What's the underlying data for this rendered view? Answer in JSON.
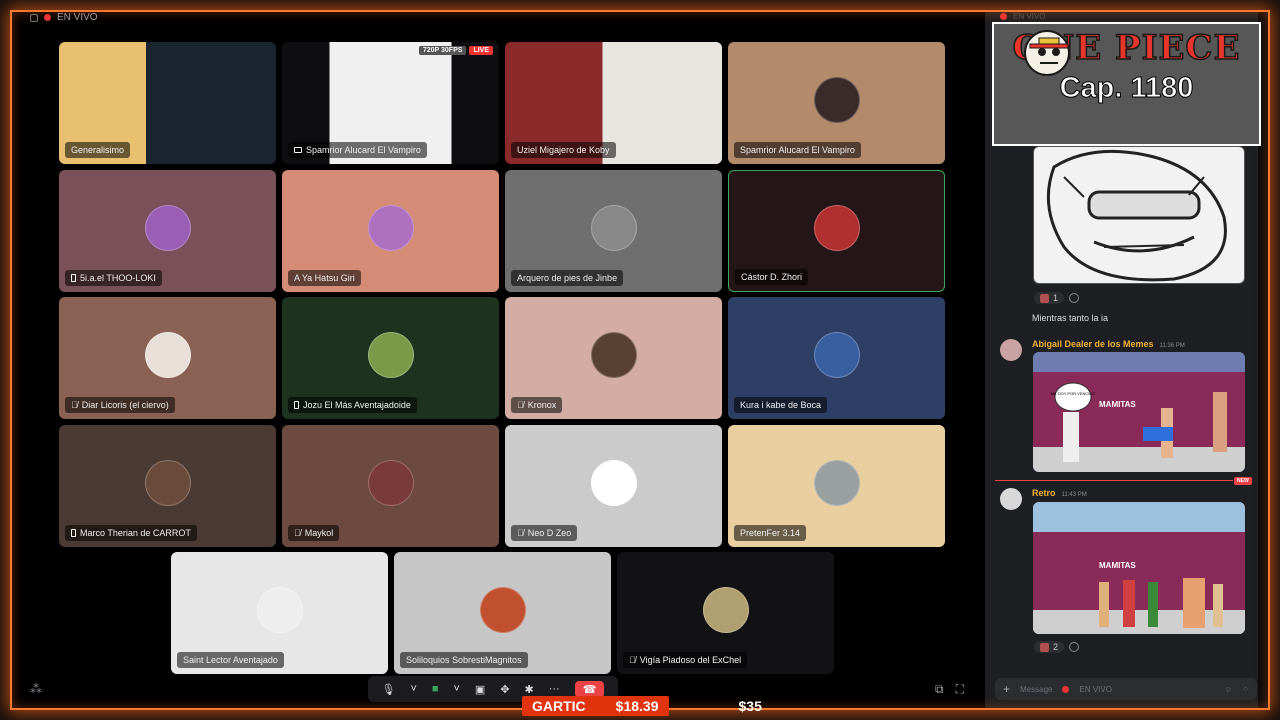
{
  "stage": {
    "live_label": "EN VIVO"
  },
  "tiles": [
    {
      "label": "Generalisimo",
      "icon": "none",
      "bg": "#1a2a3a"
    },
    {
      "label": "Spamrior Alucard El Vampiro",
      "icon": "screen-icon",
      "bg": "#0e0e10",
      "stream_quality": "720P 30FPS",
      "stream_live": "LIVE"
    },
    {
      "label": "Uziel Migajero de Koby",
      "icon": "none",
      "bg": "#3a2a28"
    },
    {
      "label": "Spamrior Alucard El Vampiro",
      "icon": "none",
      "bg": "#b38a6a"
    },
    {
      "label": "5i.a.el THOO-LOKI",
      "icon": "phone-icon",
      "bg": "#7a5158"
    },
    {
      "label": "A Ya Hatsu Giri",
      "icon": "none",
      "bg": "#d48c76"
    },
    {
      "label": "Arquero de pies de Jinbe",
      "icon": "none",
      "bg": "#6f6f6f"
    },
    {
      "label": "Cástor D. Zhori",
      "icon": "none",
      "bg": "#231518"
    },
    {
      "label": "Diar Licoris (el ciervo)",
      "icon": "muted-mic-icon",
      "bg": "#8a6253"
    },
    {
      "label": "Jozu El Más Aventajadoide",
      "icon": "phone-icon",
      "bg": "#1e3220"
    },
    {
      "label": "Kronox",
      "icon": "muted-mic-icon",
      "bg": "#d3aca3"
    },
    {
      "label": "Kura i kabe de Boca",
      "icon": "none",
      "bg": "#2e3f66"
    },
    {
      "label": "Marco Therian de CARROT",
      "icon": "phone-icon",
      "bg": "#4a3a33"
    },
    {
      "label": "Maykol",
      "icon": "muted-mic-icon",
      "bg": "#6c4a40"
    },
    {
      "label": "Neo D Zeo",
      "icon": "muted-mic-icon",
      "bg": "#cbcbcb"
    },
    {
      "label": "PretenFer 3.14",
      "icon": "none",
      "bg": "#e9cfa0"
    },
    {
      "label": "Saint Lector Aventajado",
      "icon": "none",
      "bg": "#e7e7e7"
    },
    {
      "label": "Soliloquios SobrestiMagnitos",
      "icon": "none",
      "bg": "#c6c6c6"
    },
    {
      "label": "Vigía Piadoso del ExChel",
      "icon": "muted-mic-icon",
      "bg": "#121214"
    }
  ],
  "overlay": {
    "title": "GARTIC",
    "amount_1": "$18.39",
    "amount_2": "$35"
  },
  "sidebar": {
    "top_live_label": "EN VIVO",
    "banner_title": "ONE PIECE",
    "banner_chapter": "Cap. 1180",
    "reaction1_count": "1",
    "message1_text": "Mientras tanto la ia",
    "message2_user": "Abigail Dealer de los Memes",
    "message2_time": "11:36 PM",
    "message2_image_text1": "ME DOY POR VENCIDO",
    "message2_image_text2": "MAMITAS",
    "new_badge": "NEW",
    "message3_user": "Retro",
    "message3_time": "11:43 PM",
    "message3_image_text": "MAMITAS",
    "reaction3_count": "2",
    "input_placeholder": "Message",
    "input_live_label": "EN VIVO"
  },
  "colors": {
    "frame_glow": "#ff7a2e",
    "username_gold": "#f0b232",
    "danger_red": "#ed4245",
    "gartic_red": "#e0330e"
  }
}
